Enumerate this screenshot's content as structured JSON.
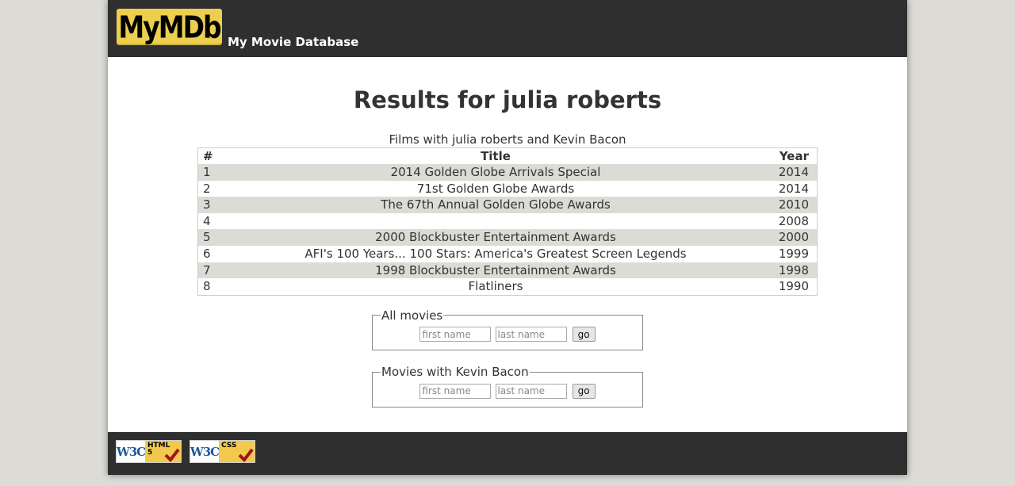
{
  "header": {
    "logo_text": "MyMDb",
    "site_name": "My Movie Database"
  },
  "results": {
    "title": "Results for julia roberts",
    "caption": "Films with julia roberts and Kevin Bacon",
    "columns": [
      "#",
      "Title",
      "Year"
    ],
    "rows": [
      {
        "num": "1",
        "title": "2014 Golden Globe Arrivals Special",
        "year": "2014"
      },
      {
        "num": "2",
        "title": "71st Golden Globe Awards",
        "year": "2014"
      },
      {
        "num": "3",
        "title": "The 67th Annual Golden Globe Awards",
        "year": "2010"
      },
      {
        "num": "4",
        "title": "",
        "year": "2008"
      },
      {
        "num": "5",
        "title": "2000 Blockbuster Entertainment Awards",
        "year": "2000"
      },
      {
        "num": "6",
        "title": "AFI's 100 Years... 100 Stars: America's Greatest Screen Legends",
        "year": "1999"
      },
      {
        "num": "7",
        "title": "1998 Blockbuster Entertainment Awards",
        "year": "1998"
      },
      {
        "num": "8",
        "title": "Flatliners",
        "year": "1990"
      }
    ]
  },
  "search_all": {
    "legend": "All movies",
    "first_placeholder": "first name",
    "last_placeholder": "last name",
    "go_label": "go"
  },
  "search_kevin": {
    "legend": "Movies with Kevin Bacon",
    "first_placeholder": "first name",
    "last_placeholder": "last name",
    "go_label": "go"
  },
  "footer": {
    "badges": [
      {
        "w3c": "W3C",
        "tag": "HTML",
        "sub": "5",
        "icon": "checkmark-icon"
      },
      {
        "w3c": "W3C",
        "tag": "CSS",
        "sub": "",
        "icon": "checkmark-icon"
      }
    ]
  },
  "colors": {
    "page_bg": "#dcdbd6",
    "banner_bg": "#2f2f2f",
    "logo_bg": "#eccf4f",
    "row_stripe": "#dcdbd6"
  }
}
